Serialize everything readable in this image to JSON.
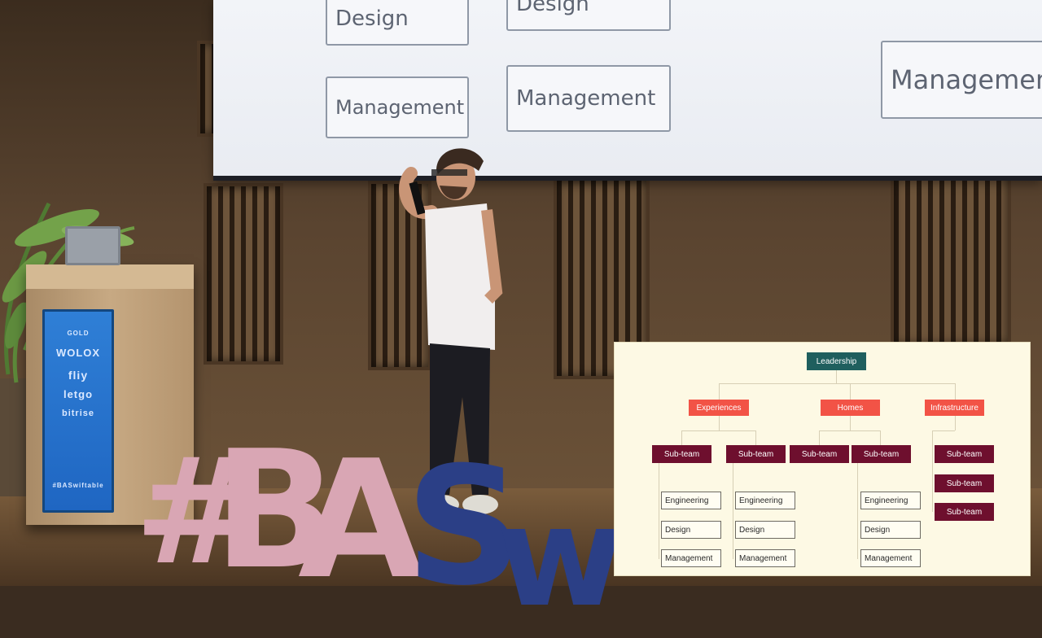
{
  "slide": {
    "boxes": [
      "Design",
      "Design",
      "Management",
      "Management",
      "Managemen"
    ]
  },
  "podium": {
    "sign_lines": [
      "GOLD",
      "WOLOX",
      "fliy",
      "letgo",
      "bitrise",
      "#BASwiftable"
    ]
  },
  "stage_letters": [
    "#",
    "B",
    "A",
    "S",
    "w"
  ],
  "org_chart": {
    "leader": "Leadership",
    "groups": [
      "Experiences",
      "Homes",
      "Infrastructure"
    ],
    "subteams": [
      "Sub-team",
      "Sub-team",
      "Sub-team",
      "Sub-team",
      "Sub-team",
      "Sub-team",
      "Sub-team"
    ],
    "roles": {
      "col1": [
        "Engineering",
        "Design",
        "Management"
      ],
      "col2": [
        "Engineering",
        "Design",
        "Management"
      ],
      "col3": [
        "Engineering",
        "Design",
        "Management"
      ]
    },
    "colors": {
      "leader": "#1f5f5e",
      "group": "#f25346",
      "subteam": "#6e0f2e",
      "background": "#fdf9e4"
    }
  }
}
